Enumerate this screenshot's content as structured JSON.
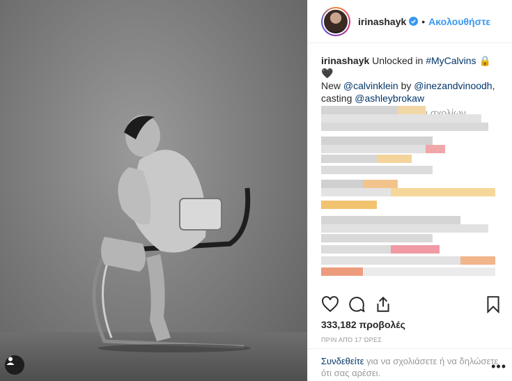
{
  "post": {
    "username": "irinashayk",
    "separator": "•",
    "follow_label": "Ακολουθήστε"
  },
  "caption": {
    "username": "irinashayk",
    "text_1": "Unlocked in ",
    "hashtag": "#MyCalvins",
    "emoji": "🔒🖤",
    "text_2": "New ",
    "mention_1": "@calvinklein",
    "text_3": " by ",
    "mention_2": "@inezandvinoodh",
    "text_4": ", casting ",
    "mention_3": "@ashleybrokaw"
  },
  "load_more_label": "Φόρτωση περισσότερων σχολίων",
  "likes_text": "333,182 προβολές",
  "time_ago": "ΠΡΙΝ ΑΠΌ 17 ΏΡΕΣ",
  "footer": {
    "login_link": "Συνδεθείτε",
    "rest_text": " για να σχολιάσετε ή να δηλώσετε ότι σας αρέσει.",
    "more_label": "•••"
  },
  "icons": {
    "like": "heart-icon",
    "comment": "comment-icon",
    "share": "share-icon",
    "save": "bookmark-icon",
    "verified": "verified-badge-icon",
    "tag": "user-tag-icon"
  },
  "colors": {
    "accent": "#3897f0",
    "link": "#003569",
    "muted": "#999999"
  }
}
